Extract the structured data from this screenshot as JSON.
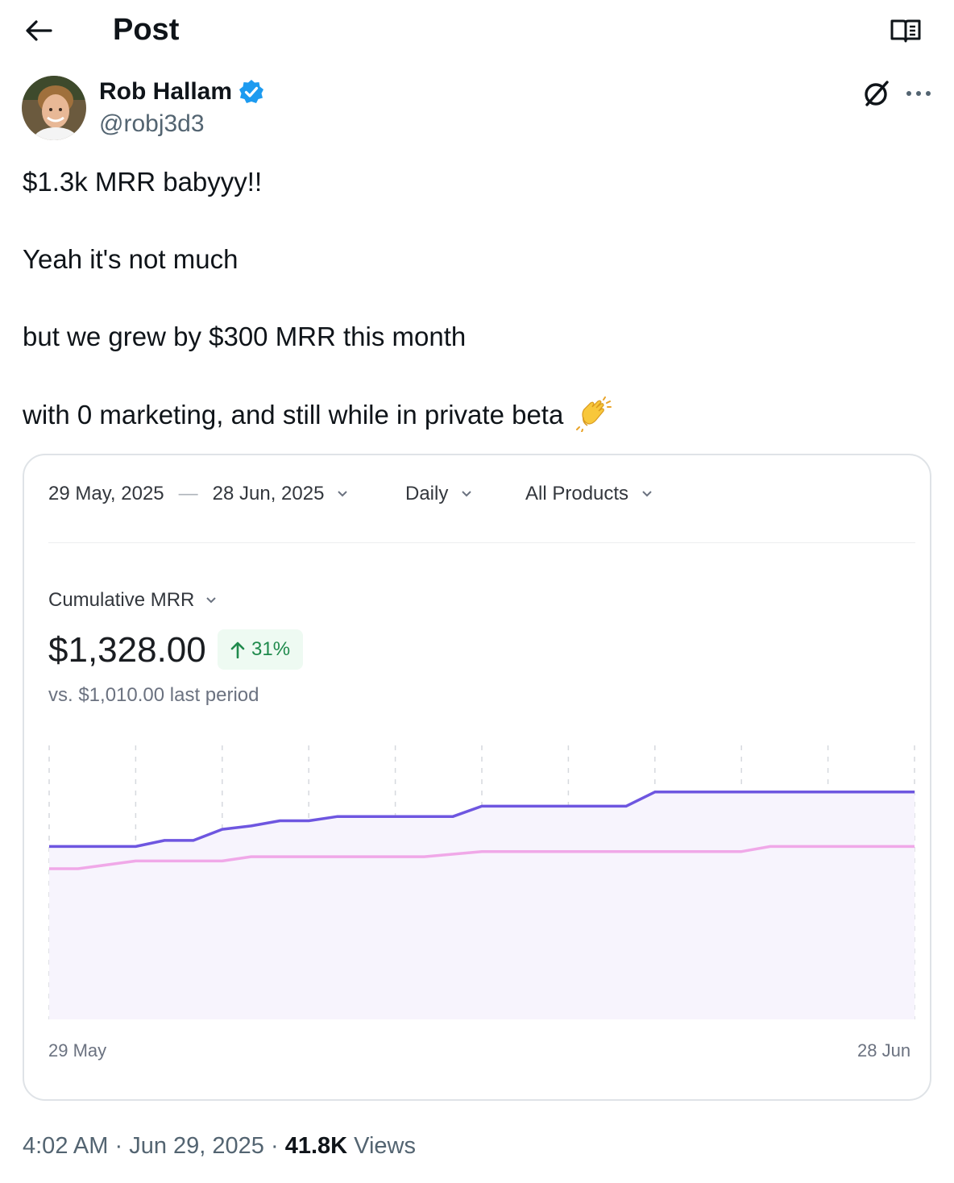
{
  "header": {
    "title": "Post",
    "back_icon": "arrow-left-icon",
    "reader_icon": "book-open-icon"
  },
  "author": {
    "name": "Rob Hallam",
    "handle": "@robj3d3",
    "verified": true,
    "verified_color": "#1d9bf0"
  },
  "post": {
    "lines": [
      "$1.3k MRR babyyy!!",
      "Yeah it's not much",
      "but we grew by $300 MRR this month",
      "with 0 marketing, and still while in private beta"
    ],
    "emoji_icon": "clapping-hands-icon"
  },
  "card": {
    "date_range_start": "29 May, 2025",
    "date_range_sep": "—",
    "date_range_end": "28 Jun, 2025",
    "interval": "Daily",
    "products": "All Products",
    "metric": "Cumulative MRR",
    "value": "$1,328.00",
    "delta": "31%",
    "delta_color": "#1f8a4c",
    "compare": "vs. $1,010.00 last period"
  },
  "chart_data": {
    "type": "line",
    "x_start_label": "29 May",
    "x_end_label": "28 Jun",
    "grid": "vertical-dashed",
    "ylim": [
      0,
      1600
    ],
    "series": [
      {
        "color": "#6e56e0",
        "points": [
          [
            0,
            1010
          ],
          [
            3,
            1010
          ],
          [
            4,
            1045
          ],
          [
            5,
            1045
          ],
          [
            6,
            1110
          ],
          [
            7,
            1130
          ],
          [
            8,
            1160
          ],
          [
            9,
            1160
          ],
          [
            10,
            1185
          ],
          [
            11,
            1185
          ],
          [
            12,
            1185
          ],
          [
            13,
            1185
          ],
          [
            14,
            1185
          ],
          [
            15,
            1245
          ],
          [
            16,
            1245
          ],
          [
            17,
            1245
          ],
          [
            18,
            1245
          ],
          [
            19,
            1245
          ],
          [
            20,
            1245
          ],
          [
            21,
            1328
          ],
          [
            30,
            1328
          ]
        ]
      },
      {
        "color": "#f0a8e8",
        "points": [
          [
            0,
            880
          ],
          [
            1,
            880
          ],
          [
            3,
            925
          ],
          [
            6,
            925
          ],
          [
            7,
            950
          ],
          [
            13,
            950
          ],
          [
            15,
            980
          ],
          [
            24,
            980
          ],
          [
            25,
            1010
          ],
          [
            30,
            1010
          ]
        ]
      }
    ]
  },
  "footer": {
    "time": "4:02 AM",
    "date": "Jun 29, 2025",
    "views_count": "41.8K",
    "views_label": "Views"
  }
}
